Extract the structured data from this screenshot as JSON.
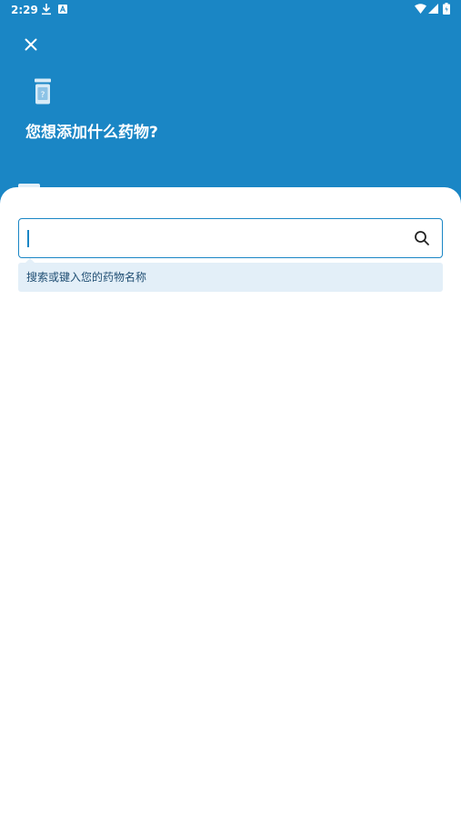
{
  "status_bar": {
    "time": "2:29",
    "icons": [
      "download-icon",
      "a-notification-icon",
      "wifi-icon",
      "signal-icon",
      "battery-icon"
    ]
  },
  "header": {
    "close_icon": "close-icon",
    "medicine_icon": "medicine-bottle-question-icon",
    "title": "您想添加什么药物?"
  },
  "search": {
    "value": "",
    "placeholder": "",
    "icon": "search-icon",
    "hint": "搜索或键入您的药物名称"
  },
  "colors": {
    "primary": "#1a86c5",
    "hint_background": "#e3eff8",
    "hint_text": "#1f4e73",
    "background": "#ffffff"
  }
}
